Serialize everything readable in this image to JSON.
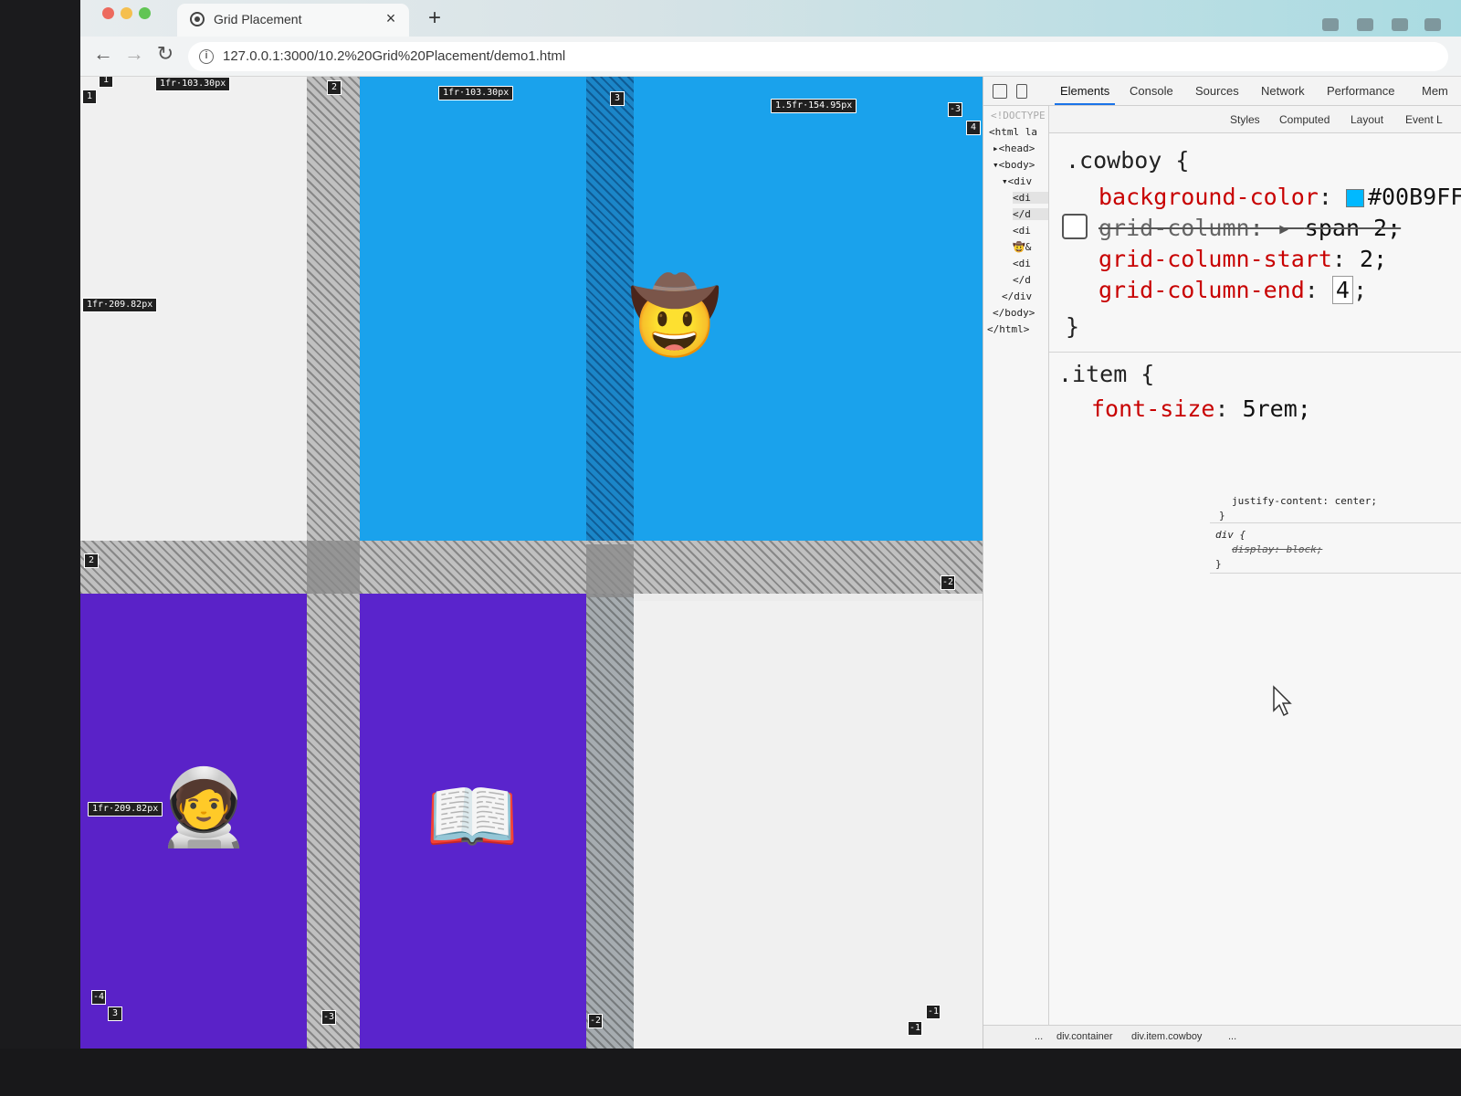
{
  "browser": {
    "tab_title": "Grid Placement",
    "tab_close": "×",
    "new_tab": "+",
    "nav_back": "←",
    "nav_forward": "→",
    "nav_reload": "↻",
    "info_glyph": "i",
    "url": "127.0.0.1:3000/10.2%20Grid%20Placement/demo1.html"
  },
  "grid_overlay": {
    "track_labels": {
      "col1": "1fr·103.30px",
      "col2": "1fr·103.30px",
      "col3": "1.5fr·154.95px",
      "row1": "1fr·209.82px",
      "row2": "1fr·209.82px"
    },
    "line_numbers": {
      "top_1": "1",
      "left_1": "1",
      "top_2": "2",
      "top_3": "3",
      "top_neg3": "-3",
      "top_4": "4",
      "left_2": "2",
      "right_neg2": "-2",
      "bottom_neg4": "-4",
      "bottom_3": "3",
      "bottom_neg3": "-3",
      "bottom_neg2": "-2",
      "bottom_neg1": "-1",
      "bottom_neg1b": "-1"
    },
    "items": {
      "cowboy_emoji": "🤠",
      "astronaut_emoji": "🧑‍🚀",
      "book_emoji": "📖"
    },
    "colors": {
      "cowboy_bg": "#1aa2ec",
      "purple_bg": "#5a22c8"
    }
  },
  "devtools": {
    "tabs": [
      "Elements",
      "Console",
      "Sources",
      "Network",
      "Performance",
      "Mem"
    ],
    "active_tab": "Elements",
    "dom_tree": [
      "<!DOCTYPE html>",
      "<html la",
      "▸<head>",
      "▾<body>",
      "▾<div",
      "<di",
      "</d",
      "<di",
      "🤠&",
      "<di",
      "</d",
      "</div",
      "</body>",
      "</html>"
    ],
    "sub_tabs": [
      "Styles",
      "Computed",
      "Layout",
      "Event L"
    ],
    "cowboy_rule": {
      "selector": ".cowboy {",
      "bg_prop": "background-color",
      "bg_val": "#00B9FF",
      "gc_prop": "grid-column",
      "gc_val": "span 2;",
      "gcs_prop": "grid-column-start",
      "gcs_val": "2;",
      "gce_prop": "grid-column-end",
      "gce_val": "4",
      "gce_tail": ";",
      "close": "}"
    },
    "item_rule": {
      "selector": ".item {",
      "fs_prop": "font-size",
      "fs_val": "5rem;",
      "jc_decl": "justify-content: center;",
      "close": "}"
    },
    "div_rule": {
      "selector": "div {",
      "display_decl": "display: block;",
      "close": "}"
    },
    "breadcrumb": [
      "...",
      "div.container",
      "div.item.cowboy",
      "..."
    ]
  }
}
